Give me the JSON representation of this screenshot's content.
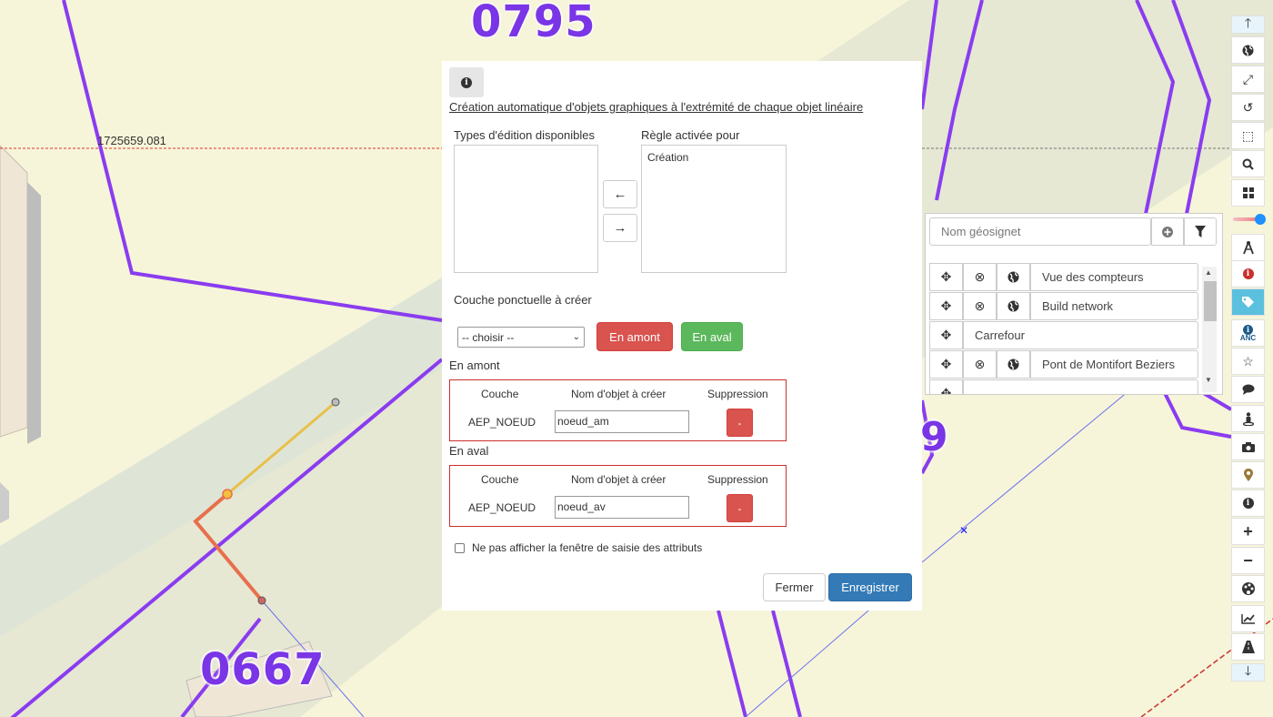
{
  "map": {
    "parcel_labels": [
      "0795",
      "0667",
      "9"
    ],
    "coordinate_label": "1725659.081",
    "colors": {
      "parcel_lines": "#8a3cf0",
      "background": "#f6f5d9",
      "road": "#e3e7d0",
      "selected_edge": "#e86f4d"
    }
  },
  "dialog": {
    "info_icon": "info-icon",
    "title": "Création automatique d'objets graphiques à l'extrémité de chaque objet linéaire",
    "available_types_label": "Types d'édition disponibles",
    "active_rule_label": "Règle activée pour",
    "active_rule_items": [
      "Création"
    ],
    "layer_label": "Couche ponctuelle à créer",
    "layer_select_value": "-- choisir --",
    "btn_amont": "En amont",
    "btn_aval": "En aval",
    "amont_section": {
      "title": "En amont",
      "headers": {
        "layer": "Couche",
        "name": "Nom d'objet à créer",
        "delete": "Suppression"
      },
      "row": {
        "layer": "AEP_NOEUD",
        "name": "noeud_am",
        "delete": "-"
      }
    },
    "aval_section": {
      "title": "En aval",
      "headers": {
        "layer": "Couche",
        "name": "Nom d'objet à créer",
        "delete": "Suppression"
      },
      "row": {
        "layer": "AEP_NOEUD",
        "name": "noeud_av",
        "delete": "-"
      }
    },
    "checkbox_label": "Ne pas afficher la fenêtre de saisie des attributs",
    "checkbox_checked": false,
    "btn_close": "Fermer",
    "btn_save": "Enregistrer"
  },
  "geosignet": {
    "placeholder": "Nom géosignet",
    "items": [
      {
        "name": "Vue des compteurs",
        "has_delete": true,
        "has_globe": true
      },
      {
        "name": "Build network",
        "has_delete": true,
        "has_globe": true
      },
      {
        "name": "Carrefour",
        "has_delete": false,
        "has_globe": false
      },
      {
        "name": "Pont de Montifort Beziers",
        "has_delete": true,
        "has_globe": true
      }
    ]
  },
  "toolbar": {
    "icons": [
      "arrow-up-icon",
      "globe-icon",
      "fullscreen-icon",
      "history-icon",
      "select-area-icon",
      "search-icon",
      "grid-icon",
      "opacity-slider",
      "compass-icon",
      "info-red-icon",
      "bookmark-tags-icon",
      "anc-info-icon",
      "star-icon",
      "comment-icon",
      "street-view-icon",
      "camera-icon",
      "map-pin-icon",
      "info-icon",
      "zoom-in-icon",
      "zoom-out-icon",
      "palette-icon",
      "line-chart-icon",
      "road-icon",
      "arrow-down-icon"
    ],
    "anc_label": "ANC",
    "opacity_level": 0.85
  }
}
